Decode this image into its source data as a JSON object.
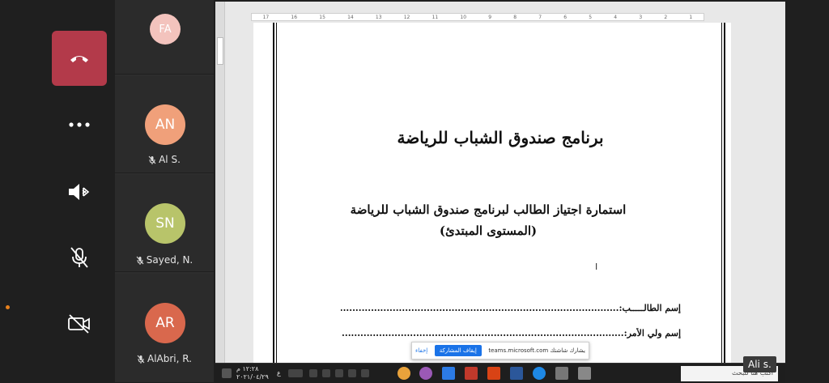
{
  "controls": {
    "end_call": "end-call",
    "more": "more-options",
    "speaker": "speaker",
    "mic": "mic-off",
    "camera": "camera-off"
  },
  "participants": [
    {
      "initials": "FA",
      "name": "",
      "color": "#f3c3bd"
    },
    {
      "initials": "AN",
      "name": "Al S.",
      "color": "#f0a07a"
    },
    {
      "initials": "SN",
      "name": "Sayed, N.",
      "color": "#b8c46a"
    },
    {
      "initials": "AR",
      "name": "AlAbri, R.",
      "color": "#d9684d"
    }
  ],
  "document": {
    "title": "برنامج صندوق الشباب للرياضة",
    "subtitle_line1": "استمارة اجتياز الطالب لبرنامج صندوق الشباب للرياضة",
    "subtitle_line2": "(المستوى المبتدئ)",
    "cursor": "I",
    "field1_label": "إسم الطالـــــب:",
    "field1_dots": "..................................................................................................",
    "field2_label": "إسم ولي الأمر:",
    "field2_dots": "..................................................................................................",
    "ruler_numbers": [
      "17",
      "16",
      "15",
      "14",
      "13",
      "12",
      "11",
      "10",
      "9",
      "8",
      "7",
      "6",
      "5",
      "4",
      "3",
      "2",
      "1"
    ]
  },
  "share_bar": {
    "text": "يشارك شاشتك teams.microsoft.com",
    "stop_label": "إيقاف المشاركة",
    "hide_label": "إخفاء"
  },
  "taskbar": {
    "search_placeholder": "اكتب هنا للبحث",
    "time": "١٢:٢٨ م",
    "date": "٢٠٢١/٠٤/٢٩",
    "lang": "ع"
  },
  "self_label": "Ali s."
}
